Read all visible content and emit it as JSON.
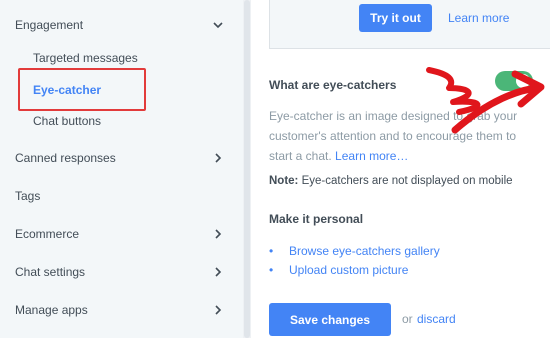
{
  "sidebar": {
    "engagement": "Engagement",
    "targeted_messages": "Targeted messages",
    "eye_catcher": "Eye-catcher",
    "chat_buttons": "Chat buttons",
    "canned_responses": "Canned responses",
    "tags": "Tags",
    "ecommerce": "Ecommerce",
    "chat_settings": "Chat settings",
    "manage_apps": "Manage apps"
  },
  "promo": {
    "try_label": "Try it out",
    "learn_label": "Learn more"
  },
  "section": {
    "title": "What are eye-catchers",
    "description": "Eye-catcher is an image designed to grab your customer's attention and to encourage them to start a chat.",
    "learn_more": "Learn more…",
    "note_label": "Note:",
    "note_text": "Eye-catchers are not displayed on mobile",
    "toggle_state": "on"
  },
  "personal": {
    "title": "Make it personal",
    "links": [
      "Browse eye-catchers gallery",
      "Upload custom picture"
    ]
  },
  "footer": {
    "save_label": "Save changes",
    "or": "or",
    "discard": "discard"
  },
  "colors": {
    "accent": "#4384f5",
    "toggle_on": "#4bb678",
    "highlight": "#e23b3b",
    "arrow": "#e0161c"
  }
}
